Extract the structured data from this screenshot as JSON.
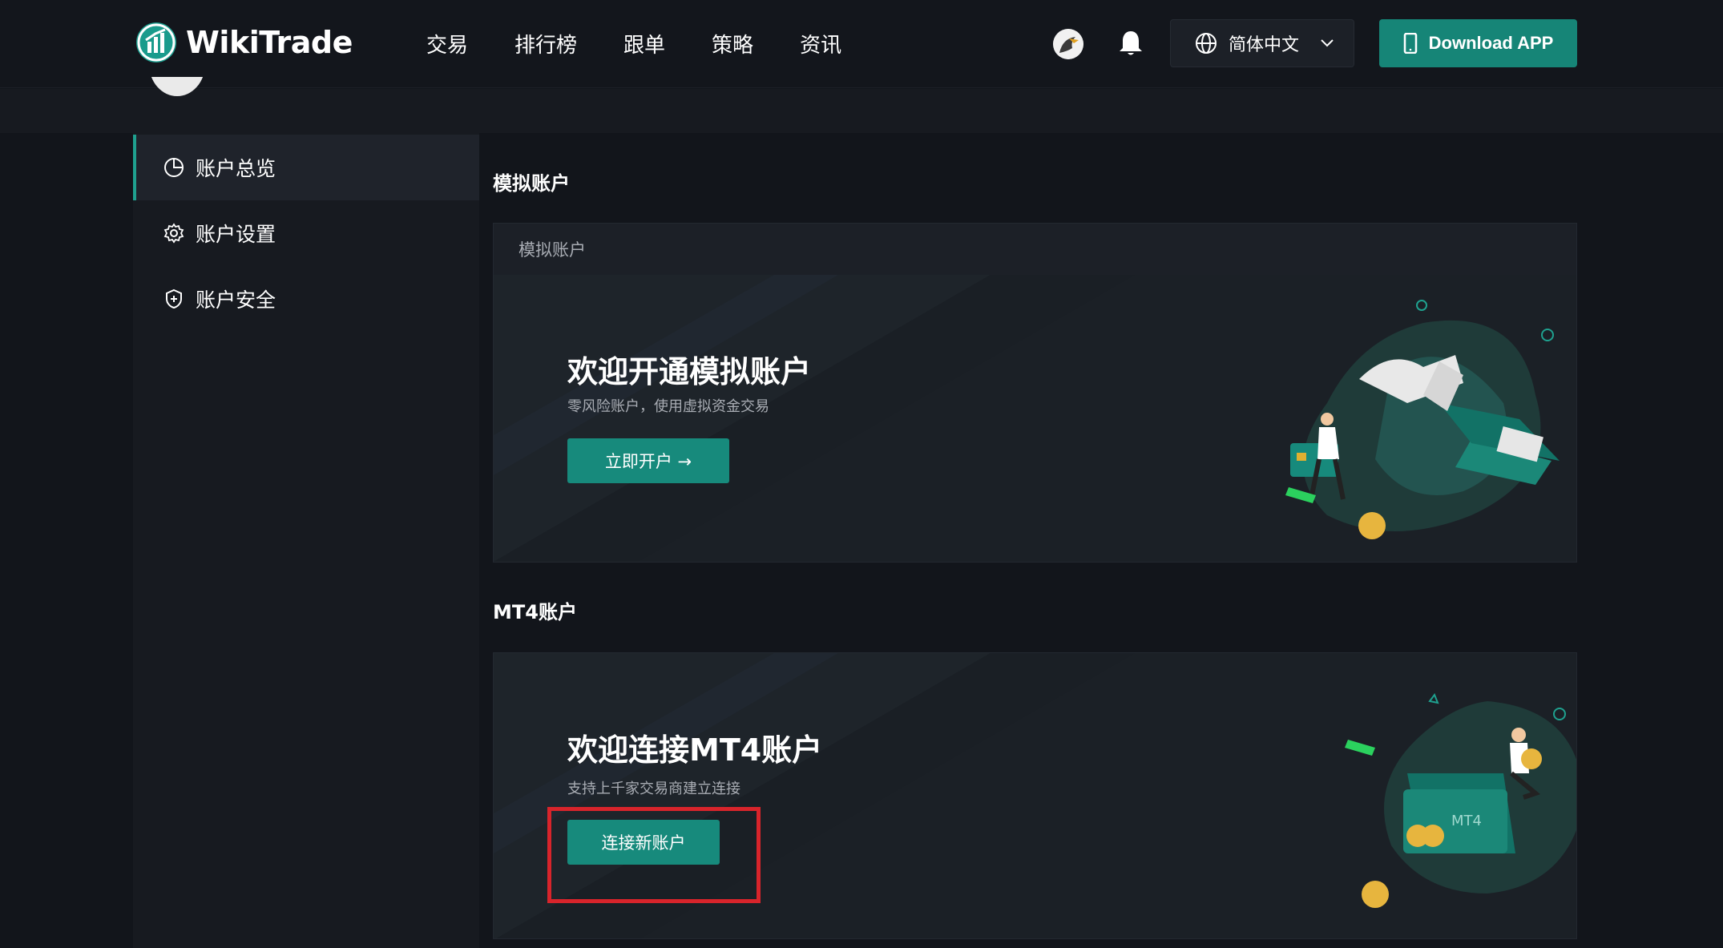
{
  "header": {
    "logo_text": "WikiTrade",
    "nav": [
      "交易",
      "排行榜",
      "跟单",
      "策略",
      "资讯"
    ],
    "language": "简体中文",
    "download_label": "Download APP"
  },
  "sidebar": {
    "items": [
      {
        "label": "账户总览",
        "icon": "pie-chart-icon",
        "active": true
      },
      {
        "label": "账户设置",
        "icon": "gear-icon",
        "active": false
      },
      {
        "label": "账户安全",
        "icon": "shield-icon",
        "active": false
      }
    ]
  },
  "demo": {
    "section_title": "模拟账户",
    "card_header": "模拟账户",
    "title": "欢迎开通模拟账户",
    "subtitle": "零风险账户，使用虚拟资金交易",
    "button": "立即开户 →"
  },
  "mt4": {
    "section_title": "MT4账户",
    "title": "欢迎连接MT4账户",
    "subtitle": "支持上千家交易商建立连接",
    "button": "连接新账户",
    "card_label": "MT4"
  },
  "colors": {
    "accent": "#168577",
    "highlight_box": "#d8242b",
    "background": "#12151b"
  }
}
